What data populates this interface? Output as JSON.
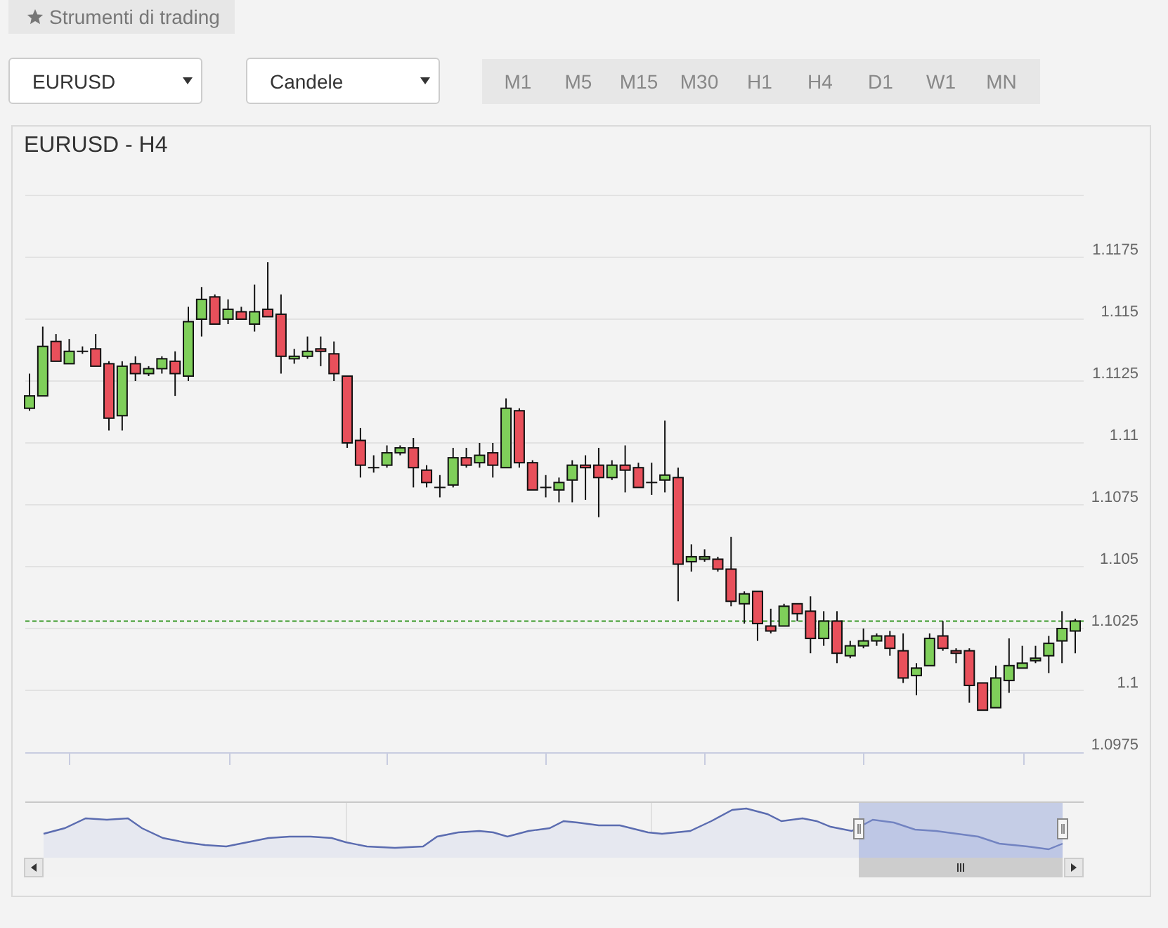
{
  "toolbar_tab": {
    "label": "Strumenti di trading"
  },
  "symbol_select": {
    "value": "EURUSD"
  },
  "chart_type_select": {
    "value": "Candele"
  },
  "timeframes": [
    {
      "label": "M1",
      "selected": false
    },
    {
      "label": "M5",
      "selected": false
    },
    {
      "label": "M15",
      "selected": false
    },
    {
      "label": "M30",
      "selected": false
    },
    {
      "label": "H1",
      "selected": false
    },
    {
      "label": "H4",
      "selected": false
    },
    {
      "label": "D1",
      "selected": false
    },
    {
      "label": "W1",
      "selected": false
    },
    {
      "label": "MN",
      "selected": false
    }
  ],
  "chart": {
    "chart_data": {
      "type": "candlestick",
      "title": "EURUSD - H4",
      "grid": true,
      "ylim": [
        1.0975,
        1.12
      ],
      "ref_lines": [
        {
          "axis": "y",
          "value": 1.1028,
          "color": "#3a9a2a"
        }
      ],
      "yticks": [
        1.1175,
        1.115,
        1.1125,
        1.11,
        1.1075,
        1.105,
        1.1025,
        1.1,
        1.0975
      ],
      "ohlc": [
        [
          1.1114,
          1.1128,
          1.1113,
          1.1119
        ],
        [
          1.1119,
          1.1147,
          1.1119,
          1.1139
        ],
        [
          1.1141,
          1.1144,
          1.1133,
          1.1133
        ],
        [
          1.1132,
          1.1142,
          1.1132,
          1.1137
        ],
        [
          1.1137,
          1.1139,
          1.1136,
          1.1137
        ],
        [
          1.1138,
          1.1144,
          1.1131,
          1.1131
        ],
        [
          1.1132,
          1.1133,
          1.1105,
          1.111
        ],
        [
          1.1111,
          1.1133,
          1.1105,
          1.1131
        ],
        [
          1.1132,
          1.1135,
          1.1125,
          1.1128
        ],
        [
          1.1128,
          1.1131,
          1.1127,
          1.113
        ],
        [
          1.113,
          1.1135,
          1.1128,
          1.1134
        ],
        [
          1.1133,
          1.1137,
          1.1119,
          1.1128
        ],
        [
          1.1127,
          1.1155,
          1.1125,
          1.1149
        ],
        [
          1.115,
          1.1163,
          1.1143,
          1.1158
        ],
        [
          1.1159,
          1.116,
          1.1148,
          1.1148
        ],
        [
          1.115,
          1.1158,
          1.1148,
          1.1154
        ],
        [
          1.1153,
          1.1155,
          1.115,
          1.115
        ],
        [
          1.1148,
          1.1164,
          1.1145,
          1.1153
        ],
        [
          1.1154,
          1.1173,
          1.1151,
          1.1151
        ],
        [
          1.1152,
          1.116,
          1.1128,
          1.1135
        ],
        [
          1.1134,
          1.1138,
          1.1132,
          1.1135
        ],
        [
          1.1135,
          1.1143,
          1.1134,
          1.1137
        ],
        [
          1.1138,
          1.1143,
          1.1131,
          1.1137
        ],
        [
          1.1136,
          1.1141,
          1.1125,
          1.1128
        ],
        [
          1.1127,
          1.1127,
          1.1098,
          1.11
        ],
        [
          1.1101,
          1.1106,
          1.1086,
          1.1091
        ],
        [
          1.109,
          1.1095,
          1.1088,
          1.109
        ],
        [
          1.1091,
          1.1099,
          1.109,
          1.1096
        ],
        [
          1.1096,
          1.1099,
          1.1095,
          1.1098
        ],
        [
          1.1098,
          1.1102,
          1.1082,
          1.109
        ],
        [
          1.1089,
          1.1091,
          1.1082,
          1.1084
        ],
        [
          1.1082,
          1.1087,
          1.1078,
          1.1082
        ],
        [
          1.1083,
          1.1098,
          1.1082,
          1.1094
        ],
        [
          1.1094,
          1.1098,
          1.109,
          1.1091
        ],
        [
          1.1092,
          1.11,
          1.109,
          1.1095
        ],
        [
          1.1096,
          1.11,
          1.1086,
          1.1091
        ],
        [
          1.109,
          1.1118,
          1.109,
          1.1114
        ],
        [
          1.1113,
          1.1114,
          1.109,
          1.1092
        ],
        [
          1.1092,
          1.1093,
          1.1081,
          1.1081
        ],
        [
          1.1082,
          1.1087,
          1.1078,
          1.1082
        ],
        [
          1.1081,
          1.1086,
          1.1076,
          1.1084
        ],
        [
          1.1085,
          1.1093,
          1.1076,
          1.1091
        ],
        [
          1.1091,
          1.1095,
          1.1077,
          1.109
        ],
        [
          1.1091,
          1.1098,
          1.107,
          1.1086
        ],
        [
          1.1086,
          1.1093,
          1.1085,
          1.1091
        ],
        [
          1.1091,
          1.1099,
          1.108,
          1.1089
        ],
        [
          1.109,
          1.1092,
          1.1082,
          1.1082
        ],
        [
          1.1084,
          1.1092,
          1.1079,
          1.1084
        ],
        [
          1.1085,
          1.1109,
          1.108,
          1.1087
        ],
        [
          1.1086,
          1.109,
          1.1036,
          1.1051
        ],
        [
          1.1052,
          1.1059,
          1.1048,
          1.1054
        ],
        [
          1.1053,
          1.1057,
          1.1052,
          1.1054
        ],
        [
          1.1053,
          1.1054,
          1.1048,
          1.1049
        ],
        [
          1.1049,
          1.1062,
          1.1034,
          1.1036
        ],
        [
          1.1035,
          1.104,
          1.1027,
          1.1039
        ],
        [
          1.104,
          1.104,
          1.102,
          1.1027
        ],
        [
          1.1026,
          1.1033,
          1.1023,
          1.1024
        ],
        [
          1.1026,
          1.1035,
          1.1026,
          1.1034
        ],
        [
          1.1035,
          1.1035,
          1.1028,
          1.1031
        ],
        [
          1.1032,
          1.1038,
          1.1015,
          1.1021
        ],
        [
          1.1021,
          1.1032,
          1.1018,
          1.1028
        ],
        [
          1.1028,
          1.1032,
          1.1011,
          1.1015
        ],
        [
          1.1014,
          1.102,
          1.1013,
          1.1018
        ],
        [
          1.1018,
          1.1025,
          1.1017,
          1.102
        ],
        [
          1.102,
          1.1023,
          1.1018,
          1.1022
        ],
        [
          1.1022,
          1.1024,
          1.1014,
          1.1017
        ],
        [
          1.1016,
          1.1023,
          1.1003,
          1.1005
        ],
        [
          1.1006,
          1.1011,
          1.0998,
          1.1009
        ],
        [
          1.101,
          1.1023,
          1.101,
          1.1021
        ],
        [
          1.1022,
          1.1028,
          1.1016,
          1.1017
        ],
        [
          1.1016,
          1.1017,
          1.1011,
          1.1015
        ],
        [
          1.1016,
          1.1017,
          1.0995,
          1.1002
        ],
        [
          1.1003,
          1.1003,
          1.0992,
          1.0992
        ],
        [
          1.0993,
          1.101,
          1.0993,
          1.1005
        ],
        [
          1.1004,
          1.1021,
          1.0999,
          1.101
        ],
        [
          1.1009,
          1.1018,
          1.1009,
          1.1011
        ],
        [
          1.1012,
          1.1018,
          1.1011,
          1.1013
        ],
        [
          1.1014,
          1.1022,
          1.1007,
          1.1019
        ],
        [
          1.102,
          1.1032,
          1.1011,
          1.1025
        ],
        [
          1.1024,
          1.1029,
          1.1015,
          1.1028
        ]
      ]
    }
  }
}
